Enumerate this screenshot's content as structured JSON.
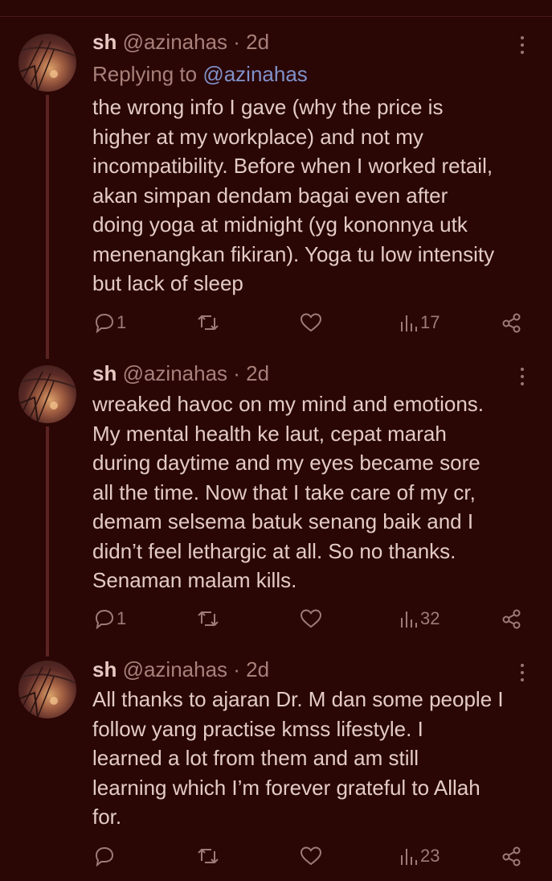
{
  "tweets": [
    {
      "name": "sh",
      "handle": "@azinahas · 2d",
      "replying_prefix": "Replying to ",
      "replying_mention": "@azinahas",
      "lines": [
        "the wrong info I gave (why the price is",
        "higher at my workplace) and not my",
        "incompatibility. Before when I worked retail,",
        "akan simpan dendam bagai even after",
        "doing yoga at midnight (yg kononnya utk",
        "menenangkan fikiran). Yoga tu low intensity",
        "but lack of sleep"
      ],
      "reply_count": "1",
      "views": "17"
    },
    {
      "name": "sh",
      "handle": "@azinahas · 2d",
      "lines": [
        "wreaked havoc on my mind and emotions.",
        "My mental health ke laut, cepat marah",
        "during daytime and my eyes became sore",
        "all the time. Now that I take care of my cr,",
        "demam selsema batuk senang baik and I",
        "didn’t feel lethargic at all. So no thanks.",
        "Senaman malam kills."
      ],
      "reply_count": "1",
      "views": "32"
    },
    {
      "name": "sh",
      "handle": "@azinahas · 2d",
      "lines": [
        "All thanks to ajaran Dr. M dan some people I",
        "follow yang practise kmss lifestyle. I",
        "learned a lot from them and am still",
        "learning which I’m forever grateful to Allah",
        "for."
      ],
      "reply_count": "",
      "views": "23"
    }
  ],
  "icons": {
    "reply": "speech-bubble-icon",
    "retweet": "retweet-icon",
    "like": "heart-icon",
    "views": "bar-chart-icon",
    "share": "share-icon",
    "more": "more-vertical-icon"
  },
  "colors": {
    "background": "#2a0605",
    "text": "#e3cbc5",
    "muted": "#a8807a",
    "mention": "#8091c9",
    "icon": "#9d7b76"
  }
}
